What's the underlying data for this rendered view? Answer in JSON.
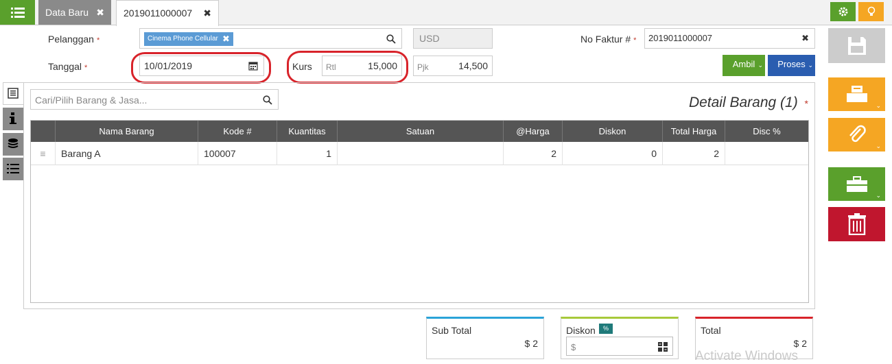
{
  "tabs": [
    {
      "label": "Data Baru"
    },
    {
      "label": "2019011000007"
    }
  ],
  "form": {
    "pelanggan_label": "Pelanggan",
    "customer_tag": "Cinema Phone Cellular",
    "currency": "USD",
    "no_faktur_label": "No Faktur #",
    "no_faktur_value": "2019011000007",
    "tanggal_label": "Tanggal",
    "tanggal_value": "10/01/2019",
    "kurs_label": "Kurs",
    "rtl_label": "Rtl",
    "rtl_value": "15,000",
    "pjk_label": "Pjk",
    "pjk_value": "14,500",
    "required_mark": "*"
  },
  "buttons": {
    "ambil": "Ambil",
    "proses": "Proses"
  },
  "items": {
    "search_placeholder": "Cari/Pilih Barang & Jasa...",
    "title": "Detail Barang (1)",
    "columns": [
      "Nama Barang",
      "Kode #",
      "Kuantitas",
      "Satuan",
      "@Harga",
      "Diskon",
      "Total Harga",
      "Disc %"
    ],
    "rows": [
      {
        "nama": "Barang A",
        "kode": "100007",
        "kuantitas": "1",
        "satuan": "",
        "harga": "2",
        "diskon": "0",
        "total": "2",
        "disc_pct": ""
      }
    ]
  },
  "summary": {
    "subtotal_label": "Sub Total",
    "subtotal_value": "$ 2",
    "diskon_label": "Diskon",
    "percent_badge": "%",
    "diskon_placeholder": "$",
    "total_label": "Total",
    "total_value": "$ 2"
  },
  "watermark": "Activate Windows",
  "colors": {
    "green": "#5aa02c",
    "orange": "#f5a623",
    "blue": "#2a5db0",
    "red": "#c0162e",
    "highlight_ring": "#d8232a"
  }
}
